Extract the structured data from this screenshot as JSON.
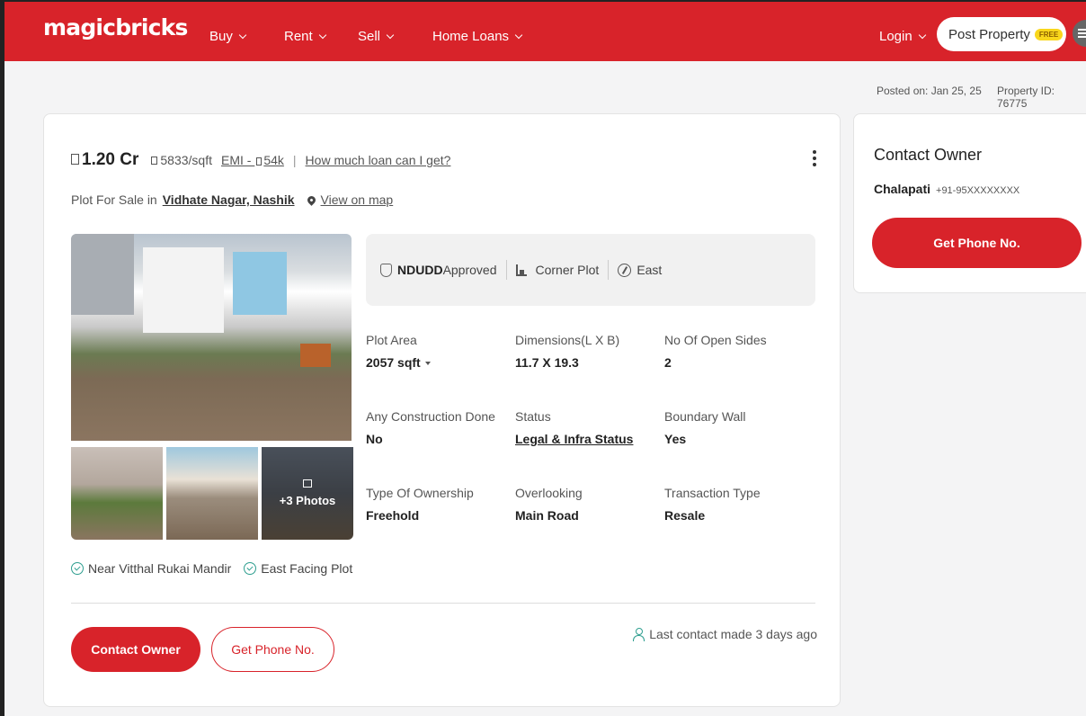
{
  "header": {
    "logo": "magicbricks",
    "nav": [
      "Buy",
      "Rent",
      "Sell",
      "Home Loans"
    ],
    "login": "Login",
    "post_property": "Post Property",
    "free_badge": "FREE",
    "brand_color": "#d8232a"
  },
  "meta": {
    "posted_on": "Posted on: Jan 25, 25",
    "property_id": "Property ID: 76775"
  },
  "listing": {
    "price": "1.20 Cr",
    "price_per_sqft": "5833/sqft",
    "emi": "EMI - ",
    "emi_value": "54k",
    "loan_link": "How much loan can I get?",
    "location_prefix": "Plot For Sale in",
    "locality": "Vidhate Nagar, Nashik",
    "view_on_map": "View on map",
    "more_photos": "+3 Photos",
    "highlights": {
      "approval_bold": "NDUDD",
      "approval_rest": "Approved",
      "corner": "Corner Plot",
      "facing": "East"
    },
    "attributes": [
      {
        "label": "Plot Area",
        "value": "2057 sqft"
      },
      {
        "label": "Dimensions(L X B)",
        "value": "11.7 X 19.3"
      },
      {
        "label": "No Of Open Sides",
        "value": "2"
      },
      {
        "label": "Any Construction Done",
        "value": "No"
      },
      {
        "label": "Status",
        "value": "Legal & Infra Status"
      },
      {
        "label": "Boundary Wall",
        "value": "Yes"
      },
      {
        "label": "Type Of Ownership",
        "value": "Freehold"
      },
      {
        "label": "Overlooking",
        "value": "Main Road"
      },
      {
        "label": "Transaction Type",
        "value": "Resale"
      }
    ],
    "tags": [
      "Near Vitthal Rukai Mandir",
      "East Facing Plot"
    ],
    "contact_owner_btn": "Contact Owner",
    "get_phone_btn": "Get Phone No.",
    "last_contact": "Last contact made 3 days ago"
  },
  "contact_card": {
    "title": "Contact Owner",
    "owner_name": "Chalapati",
    "phone_masked": "+91-95XXXXXXXX",
    "button": "Get Phone No."
  }
}
